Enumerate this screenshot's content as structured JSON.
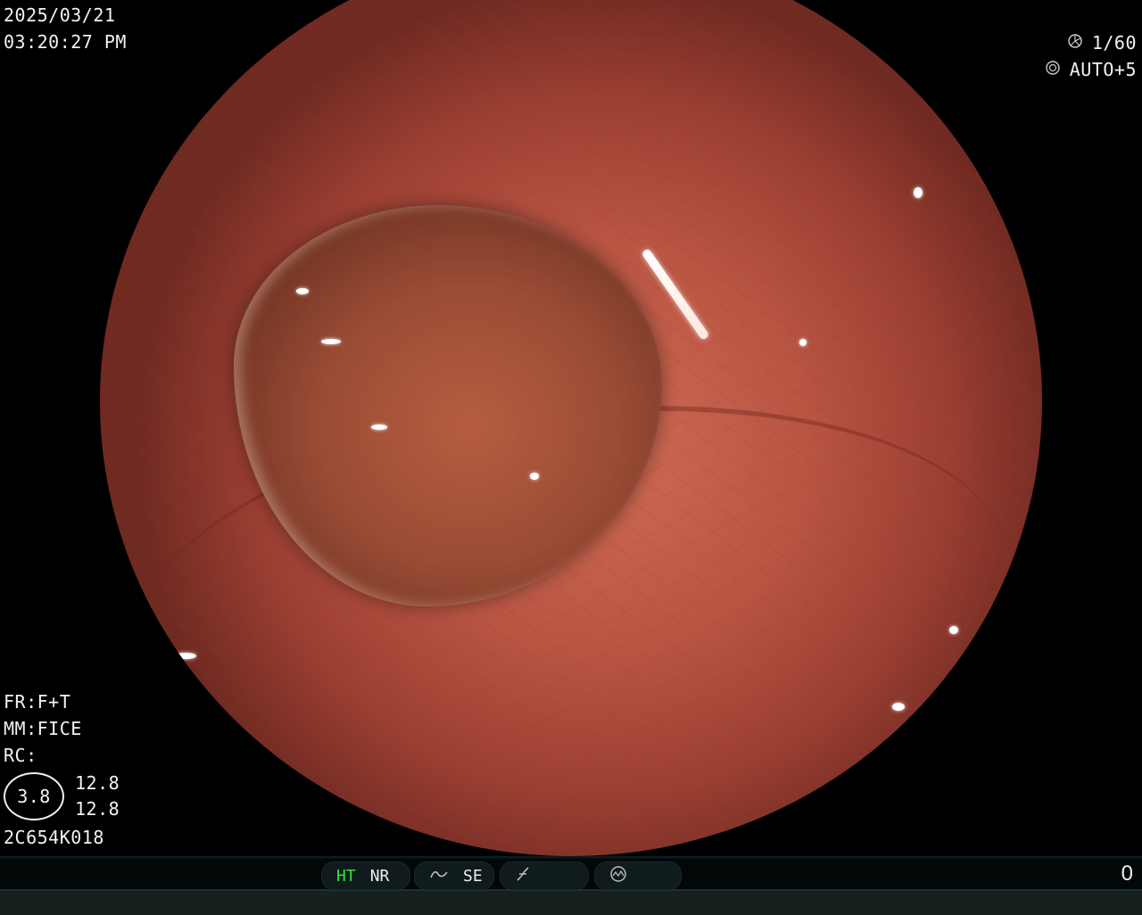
{
  "overlay": {
    "date": "2025/03/21",
    "time": "03:20:27  PM",
    "shutter": "1/60",
    "exposure": "AUTO+5",
    "fr": "FR:F+T",
    "mm": "MM:FICE",
    "rc": "RC:",
    "circle_value": "3.8",
    "value_top": "12.8",
    "value_bottom": "12.8",
    "serial": "2C654K018"
  },
  "status_bar": {
    "ht": "HT",
    "nr": "NR",
    "se": "SE",
    "counter": "0"
  },
  "icons": [
    "shutter-icon",
    "aperture-icon",
    "se-wave-icon",
    "curve-icon",
    "dial-icon"
  ],
  "colors": {
    "ht_active": "#39e23a",
    "text": "#f2f2f2",
    "bar_bg": "#0f1b1d"
  }
}
